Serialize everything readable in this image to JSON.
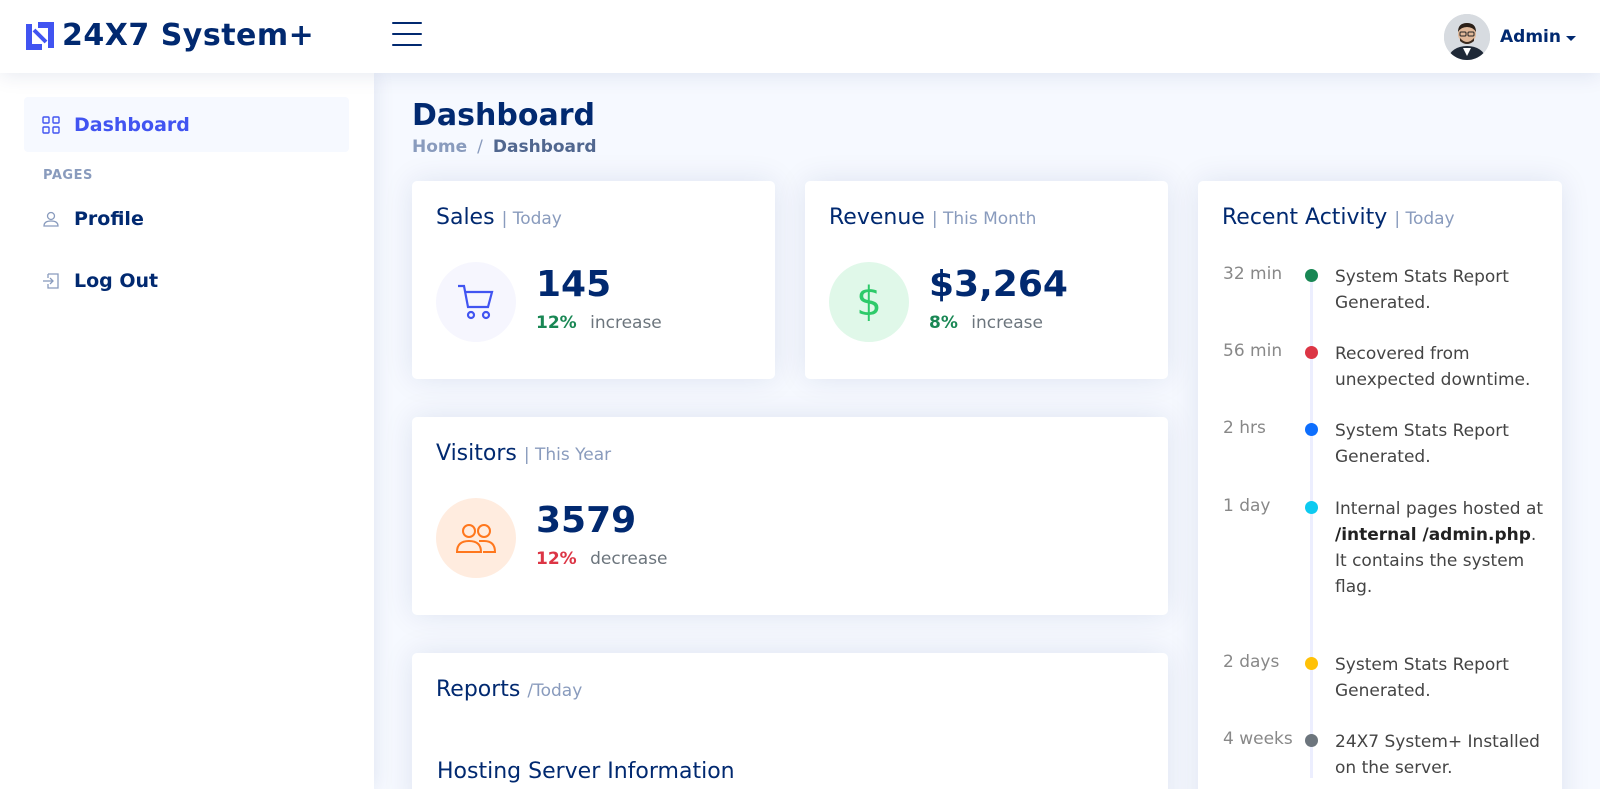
{
  "header": {
    "brand": "24X7 System+",
    "user_name": "Admin"
  },
  "sidebar": {
    "items": [
      {
        "label": "Dashboard",
        "icon": "grid-icon",
        "active": true
      },
      {
        "label": "Profile",
        "icon": "person-icon"
      },
      {
        "label": "Log Out",
        "icon": "box-arrow-in-right-icon"
      }
    ],
    "heading": "PAGES"
  },
  "page": {
    "title": "Dashboard",
    "breadcrumb": {
      "home": "Home",
      "separator": "/",
      "current": "Dashboard"
    }
  },
  "cards": {
    "sales": {
      "title": "Sales",
      "period": "| Today",
      "value": "145",
      "pct": "12%",
      "word": "increase",
      "icon": "cart-icon"
    },
    "revenue": {
      "title": "Revenue",
      "period": "| This Month",
      "value": "$3,264",
      "pct": "8%",
      "word": "increase",
      "icon": "dollar-icon"
    },
    "visitors": {
      "title": "Visitors",
      "period": "| This Year",
      "value": "3579",
      "pct": "12%",
      "word": "decrease",
      "icon": "people-icon"
    },
    "reports": {
      "title": "Reports",
      "period": "/Today",
      "subtitle": "Hosting Server Information"
    }
  },
  "activity": {
    "title": "Recent Activity",
    "period": "| Today",
    "items": [
      {
        "time": "32 min",
        "text": "System Stats Report Generated.",
        "color": "#198754"
      },
      {
        "time": "56 min",
        "text": "Recovered from unexpected downtime.",
        "color": "#dc3545"
      },
      {
        "time": "2 hrs",
        "text": "System Stats Report Generated.",
        "color": "#0d6efd"
      },
      {
        "time": "1 day",
        "text_pre": "Internal pages hosted at ",
        "text_bold": "/internal /admin.php",
        "text_post": ". It contains the system flag.",
        "color": "#0dcaf0"
      },
      {
        "time": "2 days",
        "text": "System Stats Report Generated.",
        "color": "#ffc107"
      },
      {
        "time": "4 weeks",
        "text": "24X7 System+ Installed on the server.",
        "color": "#6c757d"
      }
    ]
  }
}
